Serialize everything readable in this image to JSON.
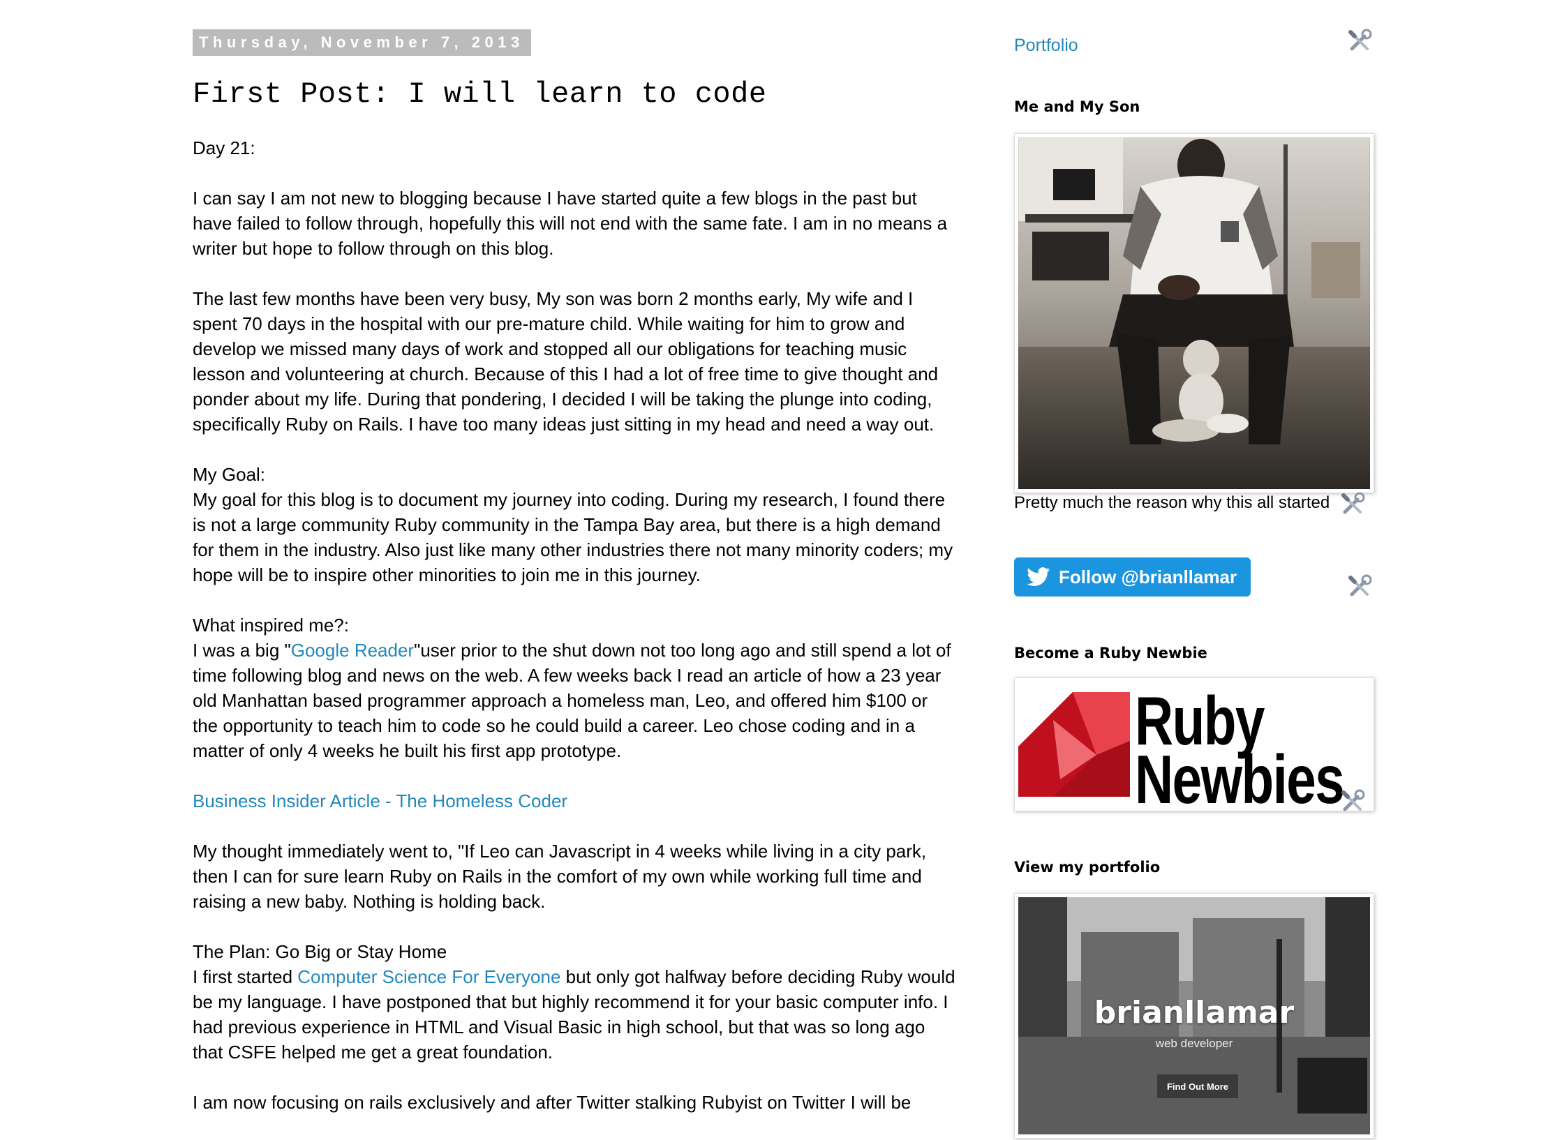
{
  "post": {
    "date": "Thursday, November 7, 2013",
    "title": "First Post: I will learn to code",
    "day": "Day 21:",
    "p1": "I can say I am not new to blogging because I have started quite a few blogs in the past but have failed to follow through, hopefully this will not end with the same fate. I am in no means a writer but hope to follow through on this blog.",
    "p2": "The last few months have been very busy, My son was born 2 months early, My wife and I spent 70 days in the hospital with our pre-mature child. While waiting for him to grow and develop we missed many days of work and stopped all our obligations for teaching music lesson and volunteering at church. Because of this I had a lot of free time to give thought and ponder about my life. During that pondering, I decided I will be taking the plunge into coding, specifically Ruby on Rails. I have too many ideas just sitting in my head and need a way out.",
    "goal_heading": "My Goal:",
    "goal_text": "My goal for this blog is to document my journey into coding. During my research, I found there is not a large community Ruby community in the Tampa Bay area, but there is a high demand for them in the industry. Also just like many other industries there not many minority coders; my hope will be to inspire other minorities to join me in this journey.",
    "inspired_heading": "What inspired me?:",
    "inspired_pre": "I was a big \"",
    "inspired_link": "Google Reader",
    "inspired_post": "\"user prior to the shut down not too long ago and still spend a lot of time following blog and news on the web. A few weeks back I read an article of how a 23 year old Manhattan based programmer approach a homeless man, Leo, and offered him $100 or the opportunity to teach him to code so he could build a career. Leo chose coding and  in a matter of only 4 weeks he built his first app prototype.",
    "article_link": "Business Insider Article - The Homeless Coder",
    "thought": "My thought immediately went to, \"If Leo can Javascript in 4 weeks while living in a city park, then I can for sure learn Ruby on Rails in the comfort of my own while working full time and raising a new baby. Nothing is holding back.",
    "plan_heading": "The Plan: Go Big or Stay Home",
    "plan_pre": "I first started ",
    "plan_link": "Computer Science For Everyone",
    "plan_post": " but only got halfway before deciding Ruby would be my language. I have postponed that but highly recommend it for your basic computer info. I had previous experience in HTML and Visual Basic in high school, but that was so long ago that CSFE helped me get a great foundation.",
    "last": "I am now focusing on rails exclusively and after Twitter stalking Rubyist on Twitter I will be"
  },
  "sidebar": {
    "portfolio_link": "Portfolio",
    "photo_title": "Me and My Son",
    "photo_caption": "Pretty much the reason why this all started",
    "follow_label": "Follow @brianllamar",
    "ruby_title": "Become a Ruby Newbie",
    "ruby_word1": "Ruby",
    "ruby_word2": "Newbies",
    "portfolio_title": "View my portfolio",
    "portfolio_brand": "brianllamar",
    "portfolio_sub": "web developer",
    "portfolio_cta": "Find Out More"
  },
  "colors": {
    "link": "#2288bb",
    "date_bg": "#bbbbbb",
    "twitter": "#1b95e0",
    "ruby_red": "#d9172b"
  },
  "icons": {
    "edit": "quick-edit-tools-icon",
    "twitter": "twitter-bird-icon"
  }
}
